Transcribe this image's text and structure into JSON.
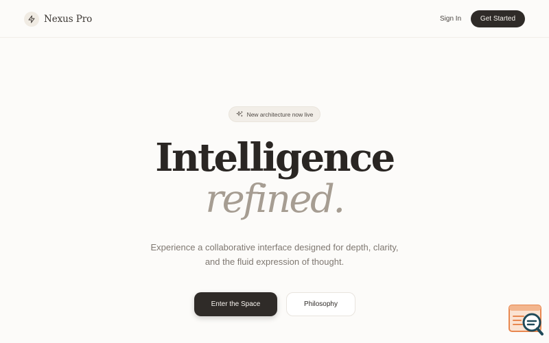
{
  "header": {
    "brand_name": "Nexus Pro",
    "brand_icon": "lightning-icon",
    "signin_label": "Sign In",
    "cta_label": "Get Started"
  },
  "hero": {
    "badge_icon": "sparkle-icon",
    "badge_text": "New architecture now live",
    "headline": "Intelligence",
    "headline_accent": "refined.",
    "subtitle_line1": "Experience a collaborative interface designed for depth, clarity,",
    "subtitle_line2": "and the fluid expression of thought.",
    "primary_button": "Enter the Space",
    "secondary_button": "Philosophy"
  },
  "widget": {
    "icon": "search-chat-icon"
  },
  "colors": {
    "background": "#fcfbf9",
    "dark": "#2f2b28",
    "accent_text": "#a69d92",
    "muted_text": "#7e7770",
    "widget_orange": "#e8874f"
  }
}
